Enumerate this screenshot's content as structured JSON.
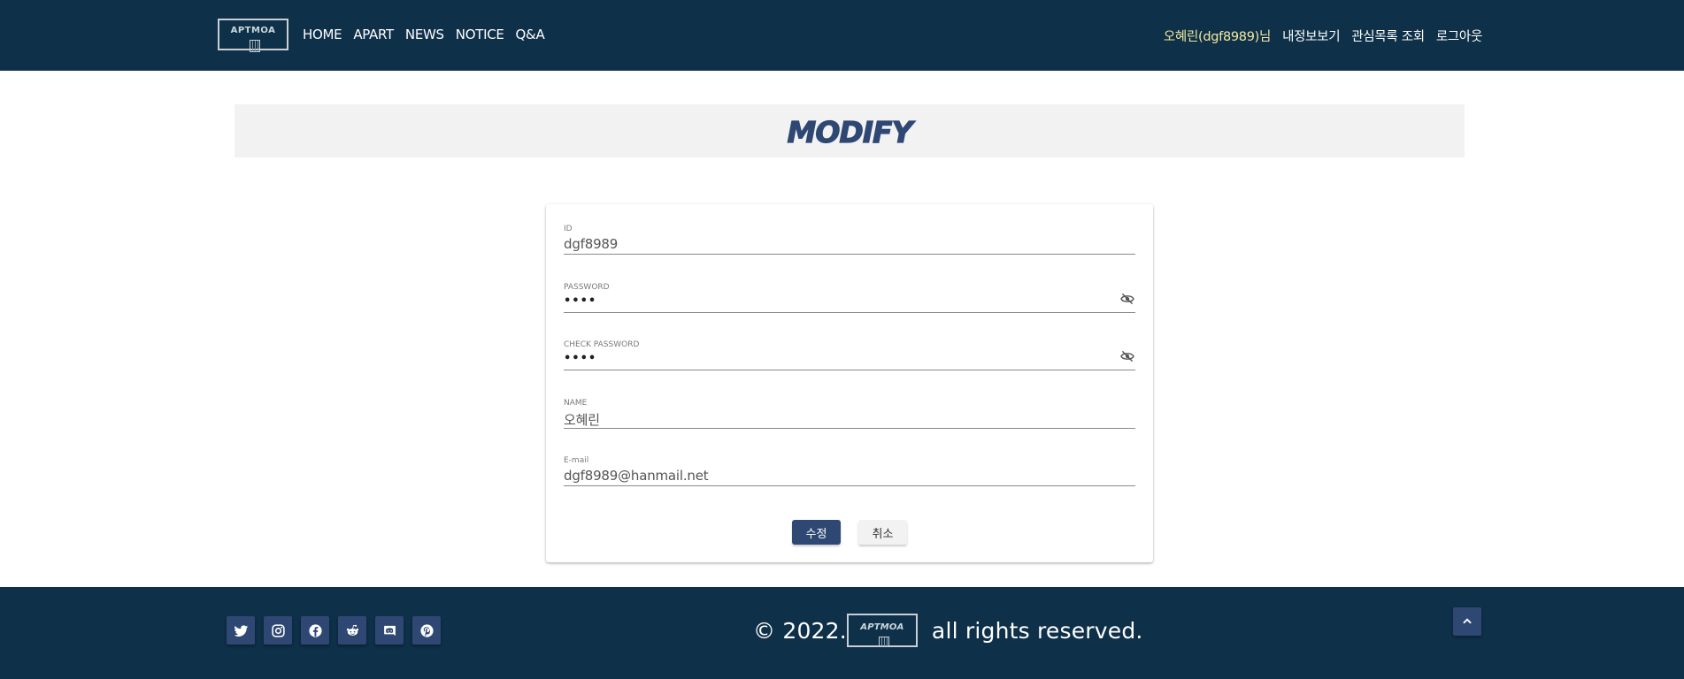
{
  "header": {
    "logo_text": "APTMOA",
    "nav": [
      "HOME",
      "APART",
      "NEWS",
      "NOTICE",
      "Q&A"
    ],
    "user_name": "오혜린(dgf8989)님",
    "user_links": [
      "내정보보기",
      "관심목록 조회",
      "로그아웃"
    ]
  },
  "page": {
    "title": "MODIFY"
  },
  "form": {
    "id_label": "ID",
    "id_value": "dgf8989",
    "password_label": "PASSWORD",
    "password_value": "••••",
    "check_password_label": "CHECK PASSWORD",
    "check_password_value": "••••",
    "name_label": "NAME",
    "name_value": "오혜린",
    "email_label": "E-mail",
    "email_value": "dgf8989@hanmail.net",
    "submit_label": "수정",
    "cancel_label": "취소"
  },
  "footer": {
    "copyright_prefix": "© 2022.",
    "copyright_suffix": "all rights reserved.",
    "logo_text": "APTMOA",
    "socials": [
      "twitter-icon",
      "instagram-icon",
      "facebook-icon",
      "reddit-icon",
      "discord-icon",
      "pinterest-icon"
    ]
  },
  "colors": {
    "header_bg": "#0f3049",
    "accent": "#2f4873",
    "user_name": "#f2eaa0"
  }
}
